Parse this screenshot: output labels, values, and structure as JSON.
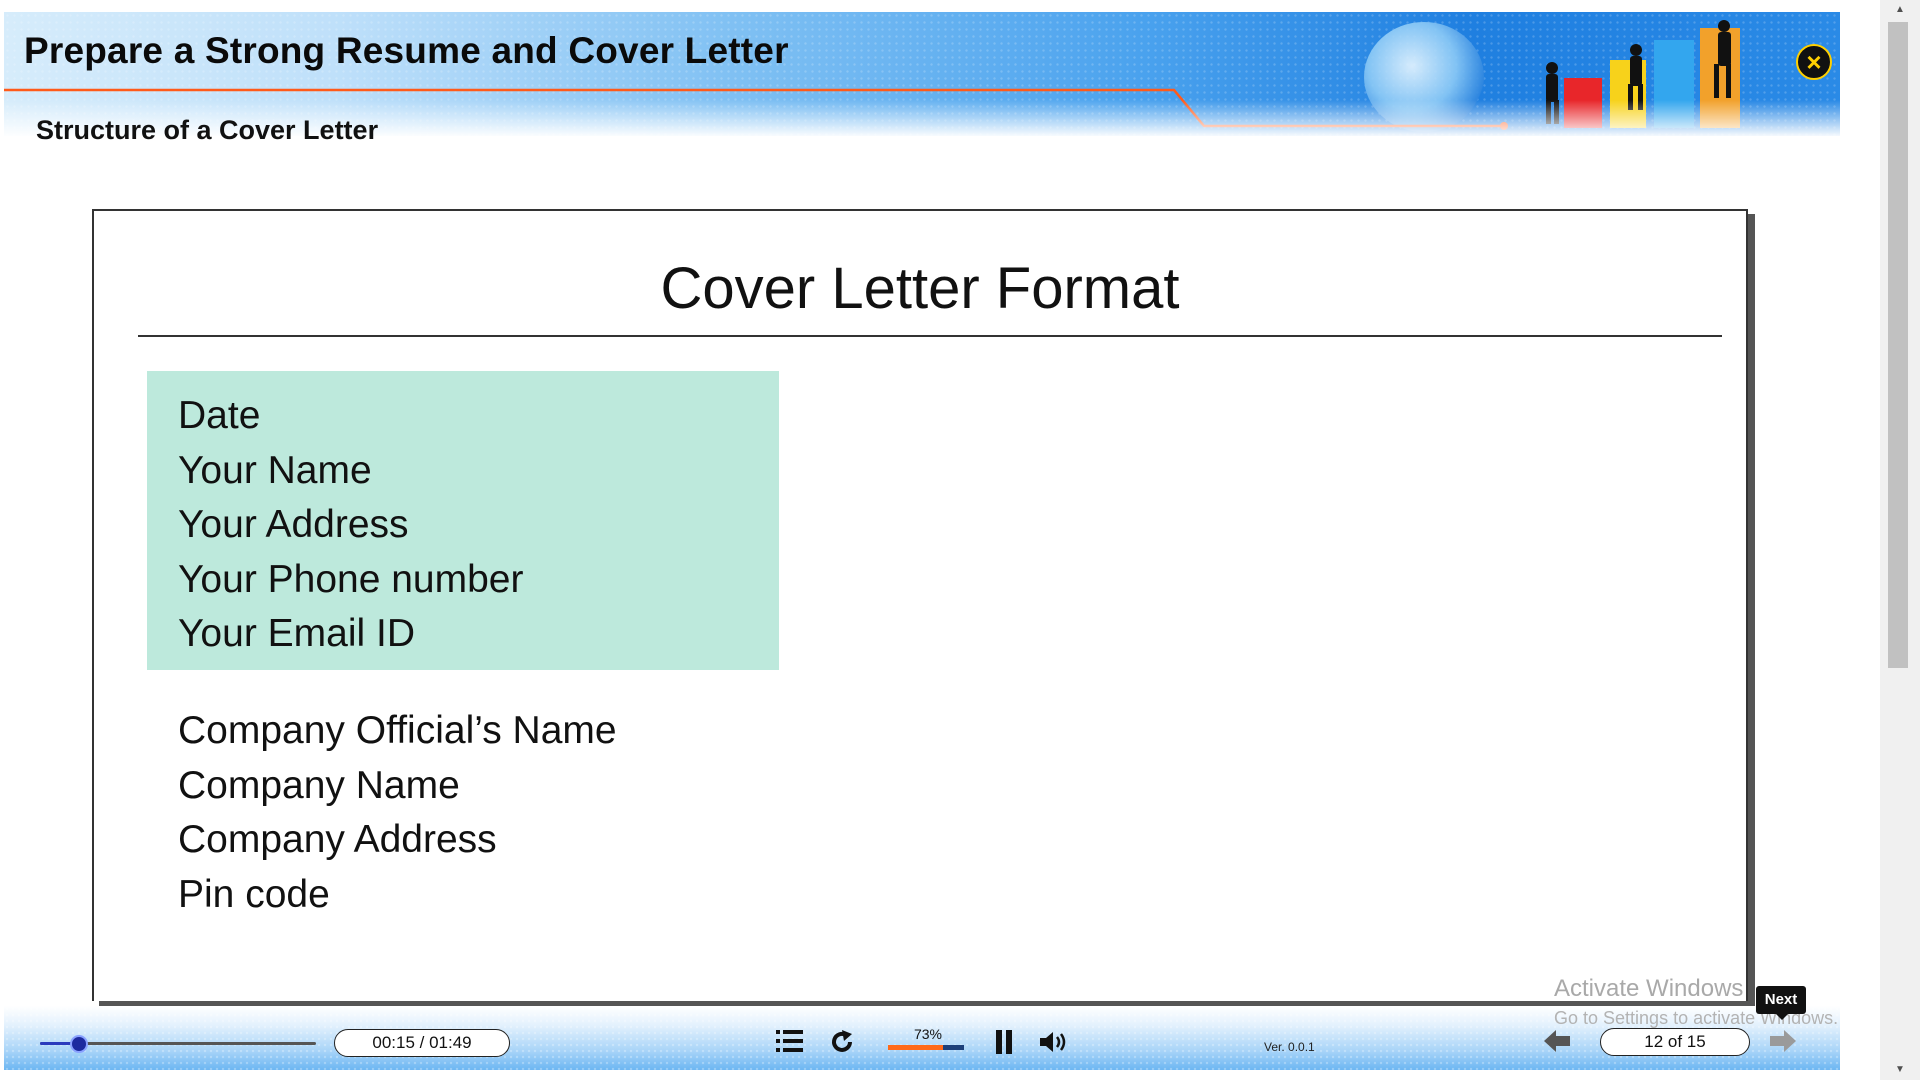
{
  "header": {
    "course_title": "Prepare a Strong Resume and Cover Letter",
    "section_title": "Structure of a Cover Letter",
    "close_icon": "close-icon"
  },
  "slide": {
    "heading": "Cover Letter Format",
    "sender_lines": [
      "Date",
      "Your Name",
      "Your Address",
      "Your Phone number",
      "Your Email ID"
    ],
    "recipient_lines": [
      "Company Official’s Name",
      "Company Name",
      "Company Address",
      "Pin code"
    ],
    "sender_box_color": "#bde9dc"
  },
  "player": {
    "time_display": "00:15 / 01:49",
    "progress": 0.14,
    "volume_label": "73%",
    "volume_level": 0.73,
    "version_label": "Ver. 0.0.1",
    "page_display": "12 of 15",
    "icons": [
      "menu-icon",
      "replay-icon",
      "pause-icon",
      "volume-icon",
      "prev-arrow-icon",
      "next-arrow-icon"
    ]
  },
  "tooltip": {
    "label": "Next"
  },
  "watermark": {
    "title": "Activate Windows",
    "subtitle": "Go to Settings to activate Windows."
  },
  "colors": {
    "accent_orange": "#ff6a1a",
    "banner_blue": "#1f7fe0"
  }
}
